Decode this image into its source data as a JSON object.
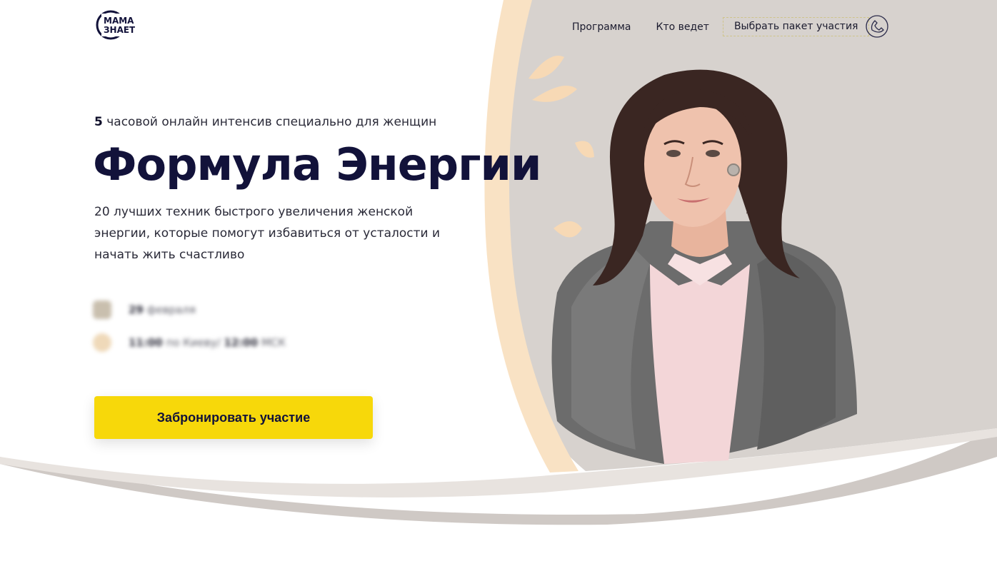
{
  "header": {
    "logo_text": "МАМА ЗНАЕТ",
    "nav": [
      "Программа",
      "Кто ведет"
    ],
    "cta_label": "Выбрать пакет участия",
    "phone_icon": "phone-icon"
  },
  "hero": {
    "eyebrow_bold": "5",
    "eyebrow_rest": " часовой онлайн интенсив специально для женщин",
    "title": "Формула Энергии",
    "subtitle": "20 лучших техник быстрого увеличения женской энергии, которые помогут избавиться от усталости и начать жить счастливо",
    "info": {
      "date_bold": "29",
      "date_rest": " февраля",
      "time_bold1": "11:00",
      "time_mid": " по Киеву/ ",
      "time_bold2": "12:00",
      "time_rest": " МСК"
    },
    "book_button": "Забронировать участие"
  },
  "colors": {
    "accent_yellow": "#f7d80a",
    "navy": "#12123a",
    "beige_bg": "#d6d1cd",
    "peach": "#f8dcb8"
  }
}
